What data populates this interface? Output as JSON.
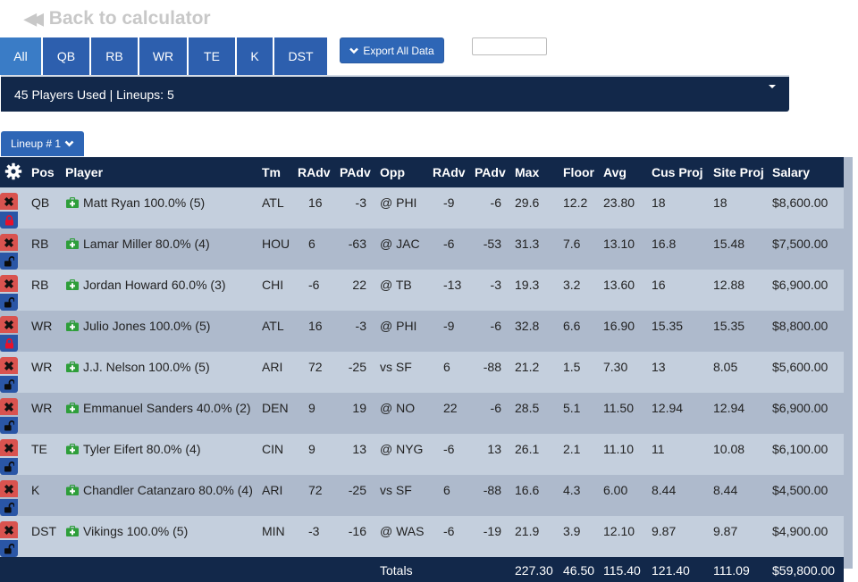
{
  "back_link": {
    "label": "Back to calculator",
    "icon": "double-chevron-left-icon"
  },
  "tabs": [
    {
      "label": "All",
      "active": true
    },
    {
      "label": "QB",
      "active": false
    },
    {
      "label": "RB",
      "active": false
    },
    {
      "label": "WR",
      "active": false
    },
    {
      "label": "TE",
      "active": false
    },
    {
      "label": "K",
      "active": false
    },
    {
      "label": "DST",
      "active": false
    }
  ],
  "export_button": {
    "label": "Export All Data",
    "icon": "chevron-down-icon"
  },
  "search": {
    "value": "",
    "placeholder": ""
  },
  "summary": {
    "text": "45 Players Used | Lineups: 5"
  },
  "lineup_selector": {
    "label": "Lineup # 1",
    "icon": "chevron-down-icon"
  },
  "table": {
    "headers": [
      "Pos",
      "Player",
      "Tm",
      "RAdv",
      "PAdv",
      "Opp",
      "RAdv",
      "PAdv",
      "Max",
      "Floor",
      "Avg",
      "Cus Proj",
      "Site Proj",
      "Salary"
    ],
    "rows": [
      {
        "locked": true,
        "pos": "QB",
        "player": "Matt Ryan 100.0% (5)",
        "tm": "ATL",
        "radv": "16",
        "padv": "-3",
        "opp": "@ PHI",
        "oradv": "-9",
        "opadv": "-6",
        "max": "29.6",
        "floor": "12.2",
        "avg": "23.80",
        "cus": "18",
        "site": "18",
        "salary": "$8,600.00"
      },
      {
        "locked": false,
        "pos": "RB",
        "player": "Lamar Miller 80.0% (4)",
        "tm": "HOU",
        "radv": "6",
        "padv": "-63",
        "opp": "@ JAC",
        "oradv": "-6",
        "opadv": "-53",
        "max": "31.3",
        "floor": "7.6",
        "avg": "13.10",
        "cus": "16.8",
        "site": "15.48",
        "salary": "$7,500.00"
      },
      {
        "locked": false,
        "pos": "RB",
        "player": "Jordan Howard 60.0% (3)",
        "tm": "CHI",
        "radv": "-6",
        "padv": "22",
        "opp": "@ TB",
        "oradv": "-13",
        "opadv": "-3",
        "max": "19.3",
        "floor": "3.2",
        "avg": "13.60",
        "cus": "16",
        "site": "12.88",
        "salary": "$6,900.00"
      },
      {
        "locked": true,
        "pos": "WR",
        "player": "Julio Jones 100.0% (5)",
        "tm": "ATL",
        "radv": "16",
        "padv": "-3",
        "opp": "@ PHI",
        "oradv": "-9",
        "opadv": "-6",
        "max": "32.8",
        "floor": "6.6",
        "avg": "16.90",
        "cus": "15.35",
        "site": "15.35",
        "salary": "$8,800.00"
      },
      {
        "locked": false,
        "pos": "WR",
        "player": "J.J. Nelson 100.0% (5)",
        "tm": "ARI",
        "radv": "72",
        "padv": "-25",
        "opp": "vs SF",
        "oradv": "6",
        "opadv": "-88",
        "max": "21.2",
        "floor": "1.5",
        "avg": "7.30",
        "cus": "13",
        "site": "8.05",
        "salary": "$5,600.00"
      },
      {
        "locked": false,
        "pos": "WR",
        "player": "Emmanuel Sanders 40.0% (2)",
        "tm": "DEN",
        "radv": "9",
        "padv": "19",
        "opp": "@ NO",
        "oradv": "22",
        "opadv": "-6",
        "max": "28.5",
        "floor": "5.1",
        "avg": "11.50",
        "cus": "12.94",
        "site": "12.94",
        "salary": "$6,900.00"
      },
      {
        "locked": false,
        "pos": "TE",
        "player": "Tyler Eifert 80.0% (4)",
        "tm": "CIN",
        "radv": "9",
        "padv": "13",
        "opp": "@ NYG",
        "oradv": "-6",
        "opadv": "13",
        "max": "26.1",
        "floor": "2.1",
        "avg": "11.10",
        "cus": "11",
        "site": "10.08",
        "salary": "$6,100.00"
      },
      {
        "locked": false,
        "pos": "K",
        "player": "Chandler Catanzaro 80.0% (4)",
        "tm": "ARI",
        "radv": "72",
        "padv": "-25",
        "opp": "vs SF",
        "oradv": "6",
        "opadv": "-88",
        "max": "16.6",
        "floor": "4.3",
        "avg": "6.00",
        "cus": "8.44",
        "site": "8.44",
        "salary": "$4,500.00"
      },
      {
        "locked": false,
        "pos": "DST",
        "player": "Vikings 100.0% (5)",
        "tm": "MIN",
        "radv": "-3",
        "padv": "-16",
        "opp": "@ WAS",
        "oradv": "-6",
        "opadv": "-19",
        "max": "21.9",
        "floor": "3.9",
        "avg": "12.10",
        "cus": "9.87",
        "site": "9.87",
        "salary": "$4,900.00"
      }
    ],
    "totals": {
      "label": "Totals",
      "max": "227.30",
      "floor": "46.50",
      "avg": "115.40",
      "cus": "121.40",
      "site": "111.09",
      "salary": "$59,800.00"
    }
  },
  "colors": {
    "primary_blue": "#2d5fae",
    "active_tab": "#3a7cc6",
    "navy": "#12284a",
    "row_light": "#c4cfdd",
    "row_dark": "#aebacc",
    "remove_red": "#d9534f",
    "lock_red": "#e8102a",
    "injury_green": "#2e9e3a"
  }
}
